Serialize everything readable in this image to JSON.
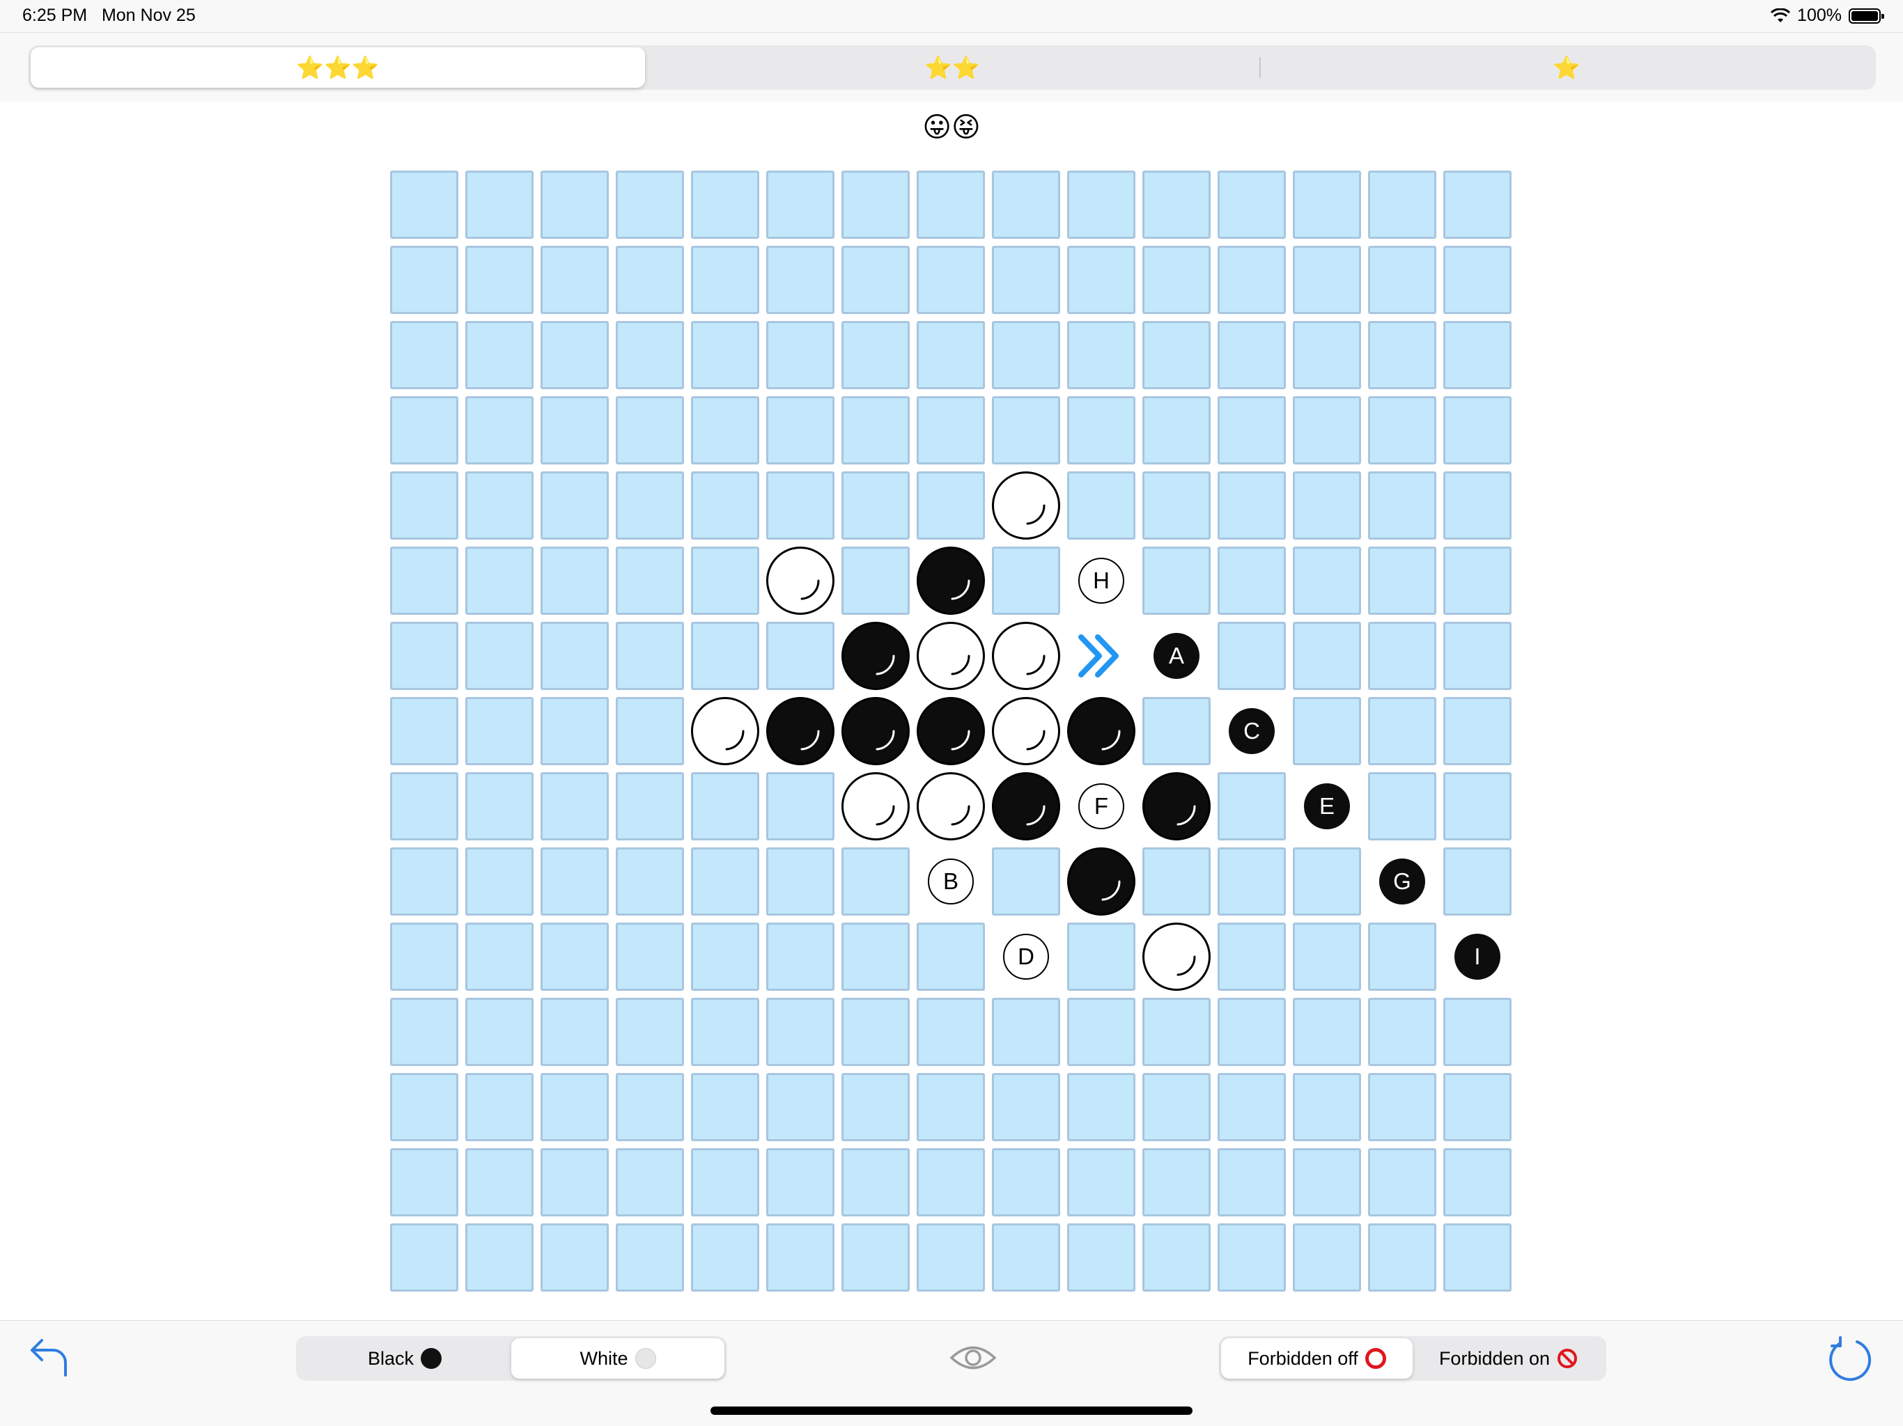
{
  "status_bar": {
    "time": "6:25 PM",
    "date": "Mon Nov 25",
    "battery": "100%",
    "wifi_icon": "wifi-icon",
    "battery_icon": "battery-icon"
  },
  "difficulty": {
    "tabs": [
      {
        "label": "⭐⭐⭐"
      },
      {
        "label": "⭐⭐"
      },
      {
        "label": "⭐"
      }
    ],
    "selected": 0
  },
  "status_emoji": "😛😝",
  "board": {
    "size": 15,
    "cell_color": "#c3e7fb",
    "stones": [
      {
        "row": 4,
        "col": 8,
        "color": "white"
      },
      {
        "row": 5,
        "col": 5,
        "color": "white"
      },
      {
        "row": 5,
        "col": 7,
        "color": "black"
      },
      {
        "row": 6,
        "col": 6,
        "color": "black"
      },
      {
        "row": 6,
        "col": 7,
        "color": "white"
      },
      {
        "row": 6,
        "col": 8,
        "color": "white"
      },
      {
        "row": 7,
        "col": 4,
        "color": "white"
      },
      {
        "row": 7,
        "col": 5,
        "color": "black"
      },
      {
        "row": 7,
        "col": 6,
        "color": "black"
      },
      {
        "row": 7,
        "col": 7,
        "color": "black"
      },
      {
        "row": 7,
        "col": 8,
        "color": "white"
      },
      {
        "row": 7,
        "col": 9,
        "color": "black"
      },
      {
        "row": 8,
        "col": 6,
        "color": "white"
      },
      {
        "row": 8,
        "col": 7,
        "color": "white"
      },
      {
        "row": 8,
        "col": 8,
        "color": "black"
      },
      {
        "row": 8,
        "col": 10,
        "color": "black"
      },
      {
        "row": 9,
        "col": 9,
        "color": "black"
      },
      {
        "row": 10,
        "col": 10,
        "color": "white"
      }
    ],
    "markers": [
      {
        "row": 5,
        "col": 9,
        "label": "H",
        "style": "white"
      },
      {
        "row": 6,
        "col": 10,
        "label": "A",
        "style": "black"
      },
      {
        "row": 7,
        "col": 11,
        "label": "C",
        "style": "black"
      },
      {
        "row": 8,
        "col": 9,
        "label": "F",
        "style": "white"
      },
      {
        "row": 8,
        "col": 12,
        "label": "E",
        "style": "black"
      },
      {
        "row": 9,
        "col": 7,
        "label": "B",
        "style": "white"
      },
      {
        "row": 9,
        "col": 13,
        "label": "G",
        "style": "black"
      },
      {
        "row": 10,
        "col": 8,
        "label": "D",
        "style": "white"
      },
      {
        "row": 10,
        "col": 14,
        "label": "I",
        "style": "black"
      }
    ],
    "arrow": {
      "row": 6,
      "col": 9,
      "icon": "double-chevron-right-icon",
      "color": "#2196f3"
    }
  },
  "toolbar": {
    "undo_icon": "undo-icon",
    "redo_icon": "redo-icon",
    "eye_icon": "eye-icon",
    "color_black_label": "Black",
    "color_white_label": "White",
    "color_selected": "white",
    "forbidden_off_label": "Forbidden off",
    "forbidden_on_label": "Forbidden on",
    "forbidden_selected": "off",
    "forbidden_off_icon": "red-ring-icon",
    "forbidden_on_icon": "prohibited-icon",
    "accent_color": "#2f7de1"
  }
}
